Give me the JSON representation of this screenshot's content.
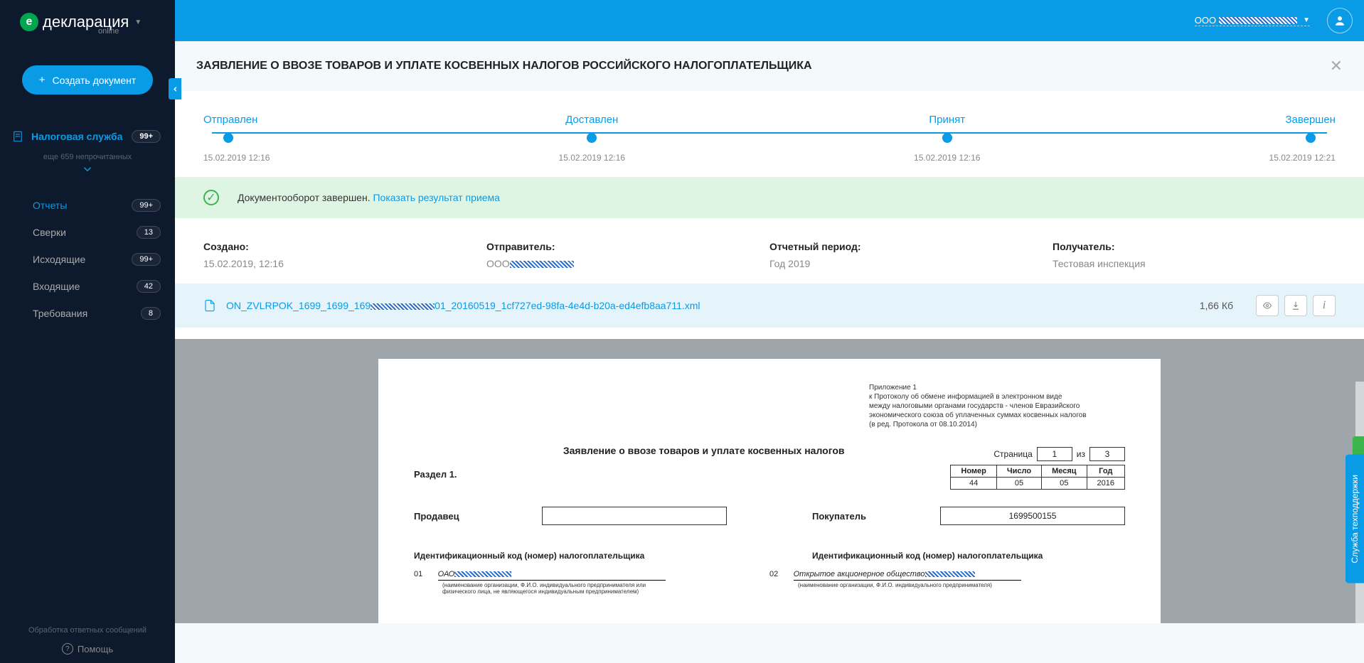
{
  "brand": {
    "letter": "е",
    "name": "декларация",
    "sub": "online"
  },
  "create_button": "Создать документ",
  "nav": {
    "top": {
      "label": "Налоговая служба",
      "badge": "99+"
    },
    "unread": "еще 659 непрочитанных",
    "items": [
      {
        "label": "Отчеты",
        "badge": "99+",
        "active": true
      },
      {
        "label": "Сверки",
        "badge": "13",
        "active": false
      },
      {
        "label": "Исходящие",
        "badge": "99+",
        "active": false
      },
      {
        "label": "Входящие",
        "badge": "42",
        "active": false
      },
      {
        "label": "Требования",
        "badge": "8",
        "active": false
      }
    ]
  },
  "footer": {
    "status": "Обработка ответных сообщений",
    "help": "Помощь"
  },
  "header": {
    "org": "ООО"
  },
  "page": {
    "title": "ЗАЯВЛЕНИЕ О ВВОЗЕ ТОВАРОВ И УПЛАТЕ КОСВЕННЫХ НАЛОГОВ РОССИЙСКОГО НАЛОГОПЛАТЕЛЬЩИКА"
  },
  "tracker": {
    "steps": [
      {
        "label": "Отправлен",
        "time": "15.02.2019 12:16"
      },
      {
        "label": "Доставлен",
        "time": "15.02.2019 12:16"
      },
      {
        "label": "Принят",
        "time": "15.02.2019 12:16"
      },
      {
        "label": "Завершен",
        "time": "15.02.2019 12:21"
      }
    ]
  },
  "banner": {
    "text": "Документооборот завершен.",
    "link": "Показать результат приема"
  },
  "details": {
    "created_label": "Создано:",
    "created_value": "15.02.2019, 12:16",
    "sender_label": "Отправитель:",
    "sender_value": "ООО",
    "period_label": "Отчетный период:",
    "period_value": "Год 2019",
    "recipient_label": "Получатель:",
    "recipient_value": "Тестовая инспекция"
  },
  "file": {
    "name_prefix": "ON_ZVLRPOK_1699_1699_169",
    "name_suffix": "01_20160519_1cf727ed-98fa-4e4d-b20a-ed4efb8aa711.xml",
    "size": "1,66 Кб"
  },
  "doc": {
    "annex": "Приложение 1\nк Протоколу об обмене информацией в электронном виде\nмежду налоговыми органами государств - членов Евразийского\nэкономического союза об уплаченных суммах косвенных налогов\n(в ред. Протокола от 08.10.2014)",
    "title": "Заявление о ввозе товаров и уплате косвенных налогов",
    "page_label": "Страница",
    "page_num": "1",
    "page_of": "из",
    "page_total": "3",
    "section": "Раздел 1.",
    "table": {
      "headers": [
        "Номер",
        "Число",
        "Месяц",
        "Год"
      ],
      "values": [
        "44",
        "05",
        "05",
        "2016"
      ]
    },
    "seller_label": "Продавец",
    "seller_value": "",
    "buyer_label": "Покупатель",
    "buyer_value": "1699500155",
    "idcode_label": "Идентификационный код (номер) налогоплательщика",
    "row01_num": "01",
    "row01_text": "ОАО",
    "row01_caption": "(наименование организации, Ф.И.О. индивидуального предпринимателя или физического лица, не являющегося индивидуальным предпринимателем)",
    "row02_num": "02",
    "row02_text": "Открытое акционерное общество",
    "row02_caption": "(наименование организации, Ф.И.О. индивидуального предпринимателя)"
  },
  "support": "Служба техподдержки"
}
